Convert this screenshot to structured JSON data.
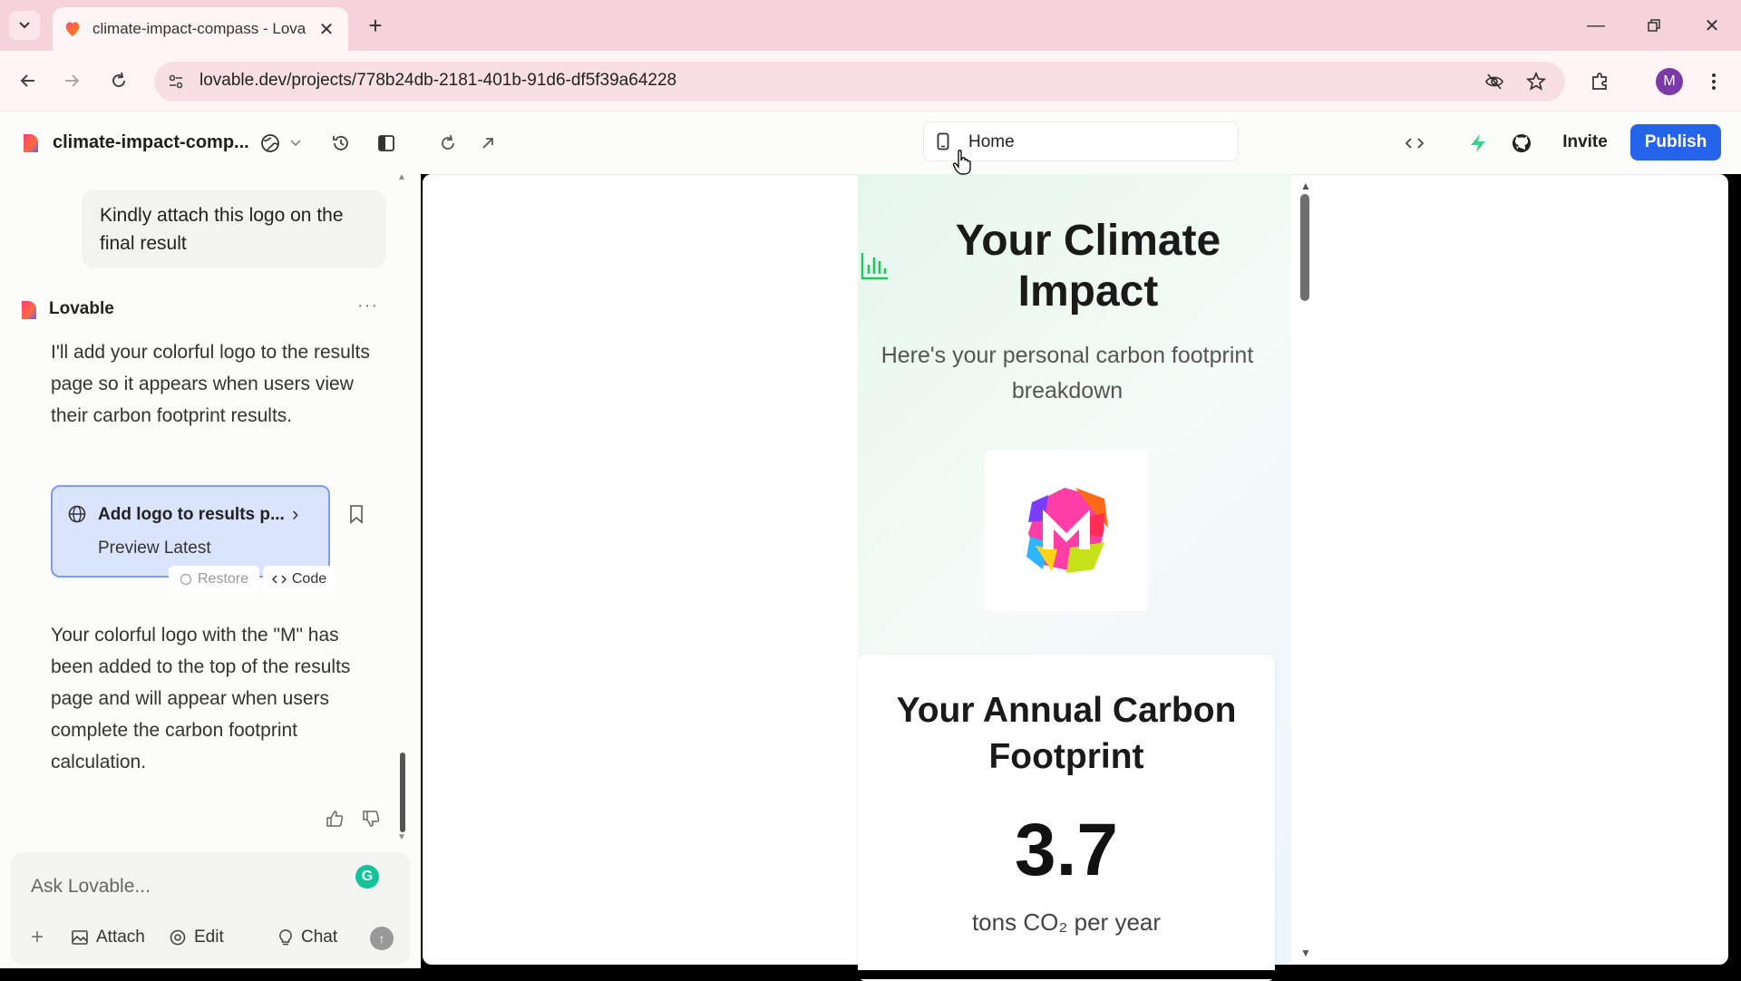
{
  "browser": {
    "tab_title": "climate-impact-compass - Lova",
    "url": "lovable.dev/projects/778b24db-2181-401b-91d6-df5f39a64228",
    "profile_initial": "M"
  },
  "app": {
    "project_name": "climate-impact-comp...",
    "route": "Home",
    "invite_label": "Invite",
    "publish_label": "Publish",
    "brand_color": "#2563eb"
  },
  "chat": {
    "user_message": "Kindly attach this logo on the final result",
    "assistant_name": "Lovable",
    "more_label": "···",
    "assistant_message_1": "I'll add your colorful logo to the results page so it appears when users view their carbon footprint results.",
    "version_card": {
      "title": "Add logo to results p...",
      "subtitle": "Preview Latest",
      "restore_label": "Restore",
      "code_label": "Code"
    },
    "assistant_message_2": "Your colorful logo with the \"M\" has been added to the top of the results page and will appear when users complete the carbon footprint calculation.",
    "input_placeholder": "Ask Lovable...",
    "toolbar": {
      "add": "+",
      "attach": "Attach",
      "edit": "Edit",
      "chat": "Chat"
    }
  },
  "preview": {
    "title": "Your Climate Impact",
    "subtitle": "Here's your personal carbon footprint breakdown",
    "logo_letter": "M",
    "footprint_title": "Your Annual Carbon Footprint",
    "footprint_value": "3.7",
    "footprint_unit": "tons CO₂ per year"
  }
}
